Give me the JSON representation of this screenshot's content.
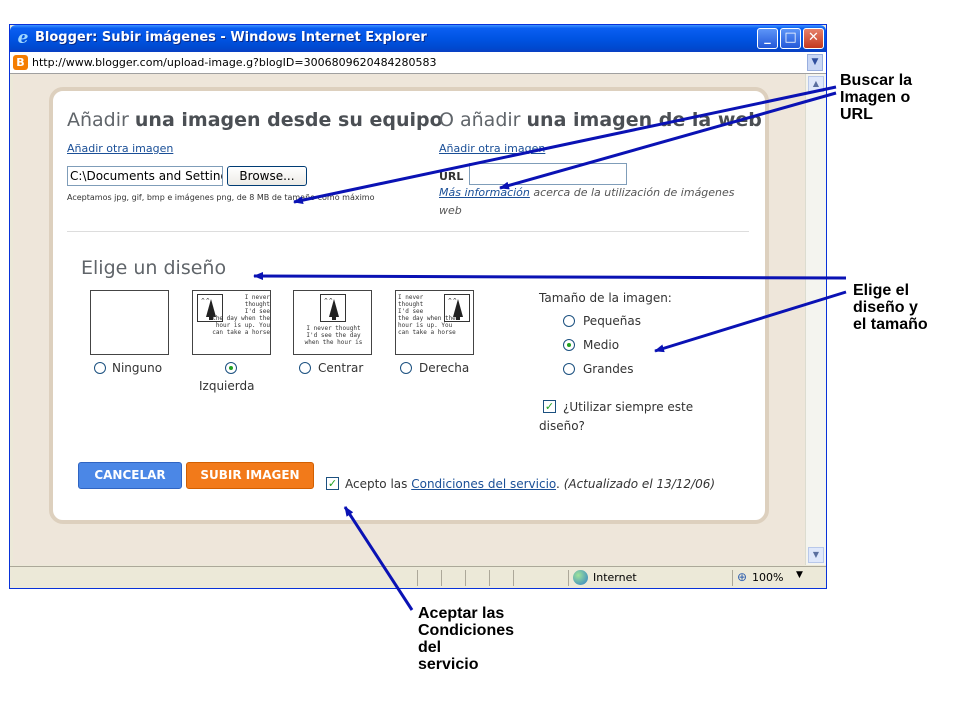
{
  "window": {
    "title": "Blogger: Subir imágenes - Windows Internet Explorer",
    "address": "http://www.blogger.com/upload-image.g?blogID=3006809620484280583",
    "status_zone": "Internet",
    "zoom": "100%"
  },
  "upload_local": {
    "heading_prefix": "Añadir",
    "heading_bold": "una imagen desde su equipo",
    "add_another": "Añadir otra imagen",
    "file_value": "C:\\Documents and Setting",
    "browse_label": "Browse...",
    "note": "Aceptamos jpg, gif, bmp e imágenes png, de 8 MB de tamaño como máximo"
  },
  "upload_web": {
    "heading_prefix": "O añadir",
    "heading_bold": "una imagen de la web",
    "add_another": "Añadir otra imagen",
    "url_label": "URL",
    "url_value": "",
    "more_info_link": "Más información",
    "more_info_rest": " acerca de la utilización de imágenes web"
  },
  "layout_section": {
    "heading": "Elige un diseño",
    "thumb_text_left": "I never\nthought\nI'd see\nthe day when the\nhour is up. You\ncan take a horse",
    "thumb_text_center": "I never thought\nI'd see the day\nwhen the hour is",
    "thumb_text_right": "I never\nthought\nI'd see\nthe day when the\nhour is up. You\ncan take a horse",
    "options": [
      {
        "label": "Ninguno",
        "selected": false
      },
      {
        "label": "Izquierda",
        "selected": true
      },
      {
        "label": "Centrar",
        "selected": false
      },
      {
        "label": "Derecha",
        "selected": false
      }
    ]
  },
  "size_section": {
    "title": "Tamaño de la imagen:",
    "options": [
      {
        "label": "Pequeñas",
        "selected": false
      },
      {
        "label": "Medio",
        "selected": true
      },
      {
        "label": "Grandes",
        "selected": false
      }
    ],
    "always_use_line1": "¿Utilizar siempre este",
    "always_use_line2": "diseño?",
    "always_use_checked": true
  },
  "actions": {
    "cancel_label": "CANCELAR",
    "upload_label": "SUBIR IMAGEN",
    "terms_prefix": "Acepto las ",
    "terms_link": "Condiciones del servicio",
    "terms_suffix": ". ",
    "terms_updated": "(Actualizado el 13/12/06)",
    "terms_checked": true
  },
  "annotations": {
    "search": [
      "Buscar la",
      "Imagen o",
      "URL"
    ],
    "layout": [
      "Elige el",
      "diseño y",
      "el tamaño"
    ],
    "terms": [
      "Aceptar las",
      "Condiciones",
      "del",
      "servicio"
    ]
  },
  "colors": {
    "arrow": "#0a12b4",
    "cancel_button": "#4b87e6",
    "upload_button": "#f27a1a",
    "link": "#1a4f97"
  }
}
